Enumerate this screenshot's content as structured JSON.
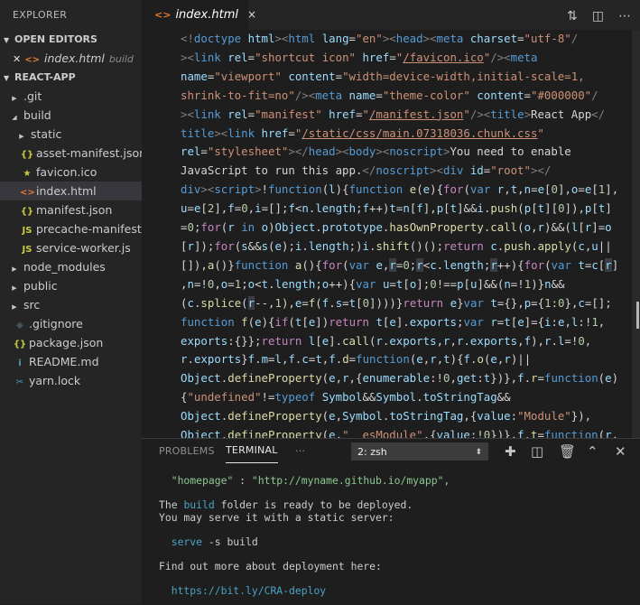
{
  "explorer": {
    "title": "EXPLORER",
    "open_editors_label": "OPEN EDITORS",
    "open_editor": {
      "name": "index.html",
      "dir": "build"
    },
    "project_label": "REACT-APP",
    "items": [
      {
        "label": ".git",
        "icon": "chevron-right",
        "indent": 1,
        "type": "folder"
      },
      {
        "label": "build",
        "icon": "chevron-down",
        "indent": 1,
        "type": "folder"
      },
      {
        "label": "static",
        "icon": "chevron-right",
        "indent": 2,
        "type": "folder"
      },
      {
        "label": "asset-manifest.json",
        "icon": "json-braces-icon",
        "glyph": "{}",
        "color": "#cbcb41",
        "indent": 2,
        "type": "file"
      },
      {
        "label": "favicon.ico",
        "icon": "star-icon",
        "glyph": "★",
        "color": "#cbcb41",
        "indent": 2,
        "type": "file"
      },
      {
        "label": "index.html",
        "icon": "html-icon",
        "glyph": "<>",
        "color": "#e37933",
        "indent": 2,
        "type": "file",
        "selected": true
      },
      {
        "label": "manifest.json",
        "icon": "json-braces-icon",
        "glyph": "{}",
        "color": "#cbcb41",
        "indent": 2,
        "type": "file"
      },
      {
        "label": "precache-manifest....",
        "icon": "js-icon",
        "glyph": "JS",
        "color": "#cbcb41",
        "indent": 2,
        "type": "file"
      },
      {
        "label": "service-worker.js",
        "icon": "js-icon",
        "glyph": "JS",
        "color": "#cbcb41",
        "indent": 2,
        "type": "file"
      },
      {
        "label": "node_modules",
        "icon": "chevron-right",
        "indent": 1,
        "type": "folder"
      },
      {
        "label": "public",
        "icon": "chevron-right",
        "indent": 1,
        "type": "folder"
      },
      {
        "label": "src",
        "icon": "chevron-right",
        "indent": 1,
        "type": "folder"
      },
      {
        "label": ".gitignore",
        "icon": "gitignore-icon",
        "glyph": "◆",
        "color": "#41535b",
        "indent": 1,
        "type": "file"
      },
      {
        "label": "package.json",
        "icon": "json-braces-icon",
        "glyph": "{}",
        "color": "#cbcb41",
        "indent": 1,
        "type": "file"
      },
      {
        "label": "README.md",
        "icon": "info-icon",
        "glyph": "i",
        "color": "#519aba",
        "indent": 1,
        "type": "file"
      },
      {
        "label": "yarn.lock",
        "icon": "yarn-icon",
        "glyph": "✂",
        "color": "#519aba",
        "indent": 1,
        "type": "file"
      }
    ]
  },
  "editor": {
    "tab": {
      "name": "index.html",
      "close": "×"
    }
  },
  "panel": {
    "tabs": [
      "PROBLEMS",
      "TERMINAL",
      "···"
    ],
    "active_tab": "TERMINAL",
    "terminal_select": "2: zsh",
    "terminal_lines": {
      "homepage_key": "\"homepage\"",
      "homepage_sep": " : ",
      "homepage_val": "\"http://myname.github.io/myapp\",",
      "ready_1": "The ",
      "ready_build": "build",
      "ready_2": " folder is ready to be deployed.",
      "serve_hint": "You may serve it with a static server:",
      "serve_cmd": "serve",
      "serve_args": " -s build",
      "more": "Find out more about deployment here:",
      "url": "https://bit.ly/CRA-deploy"
    }
  }
}
